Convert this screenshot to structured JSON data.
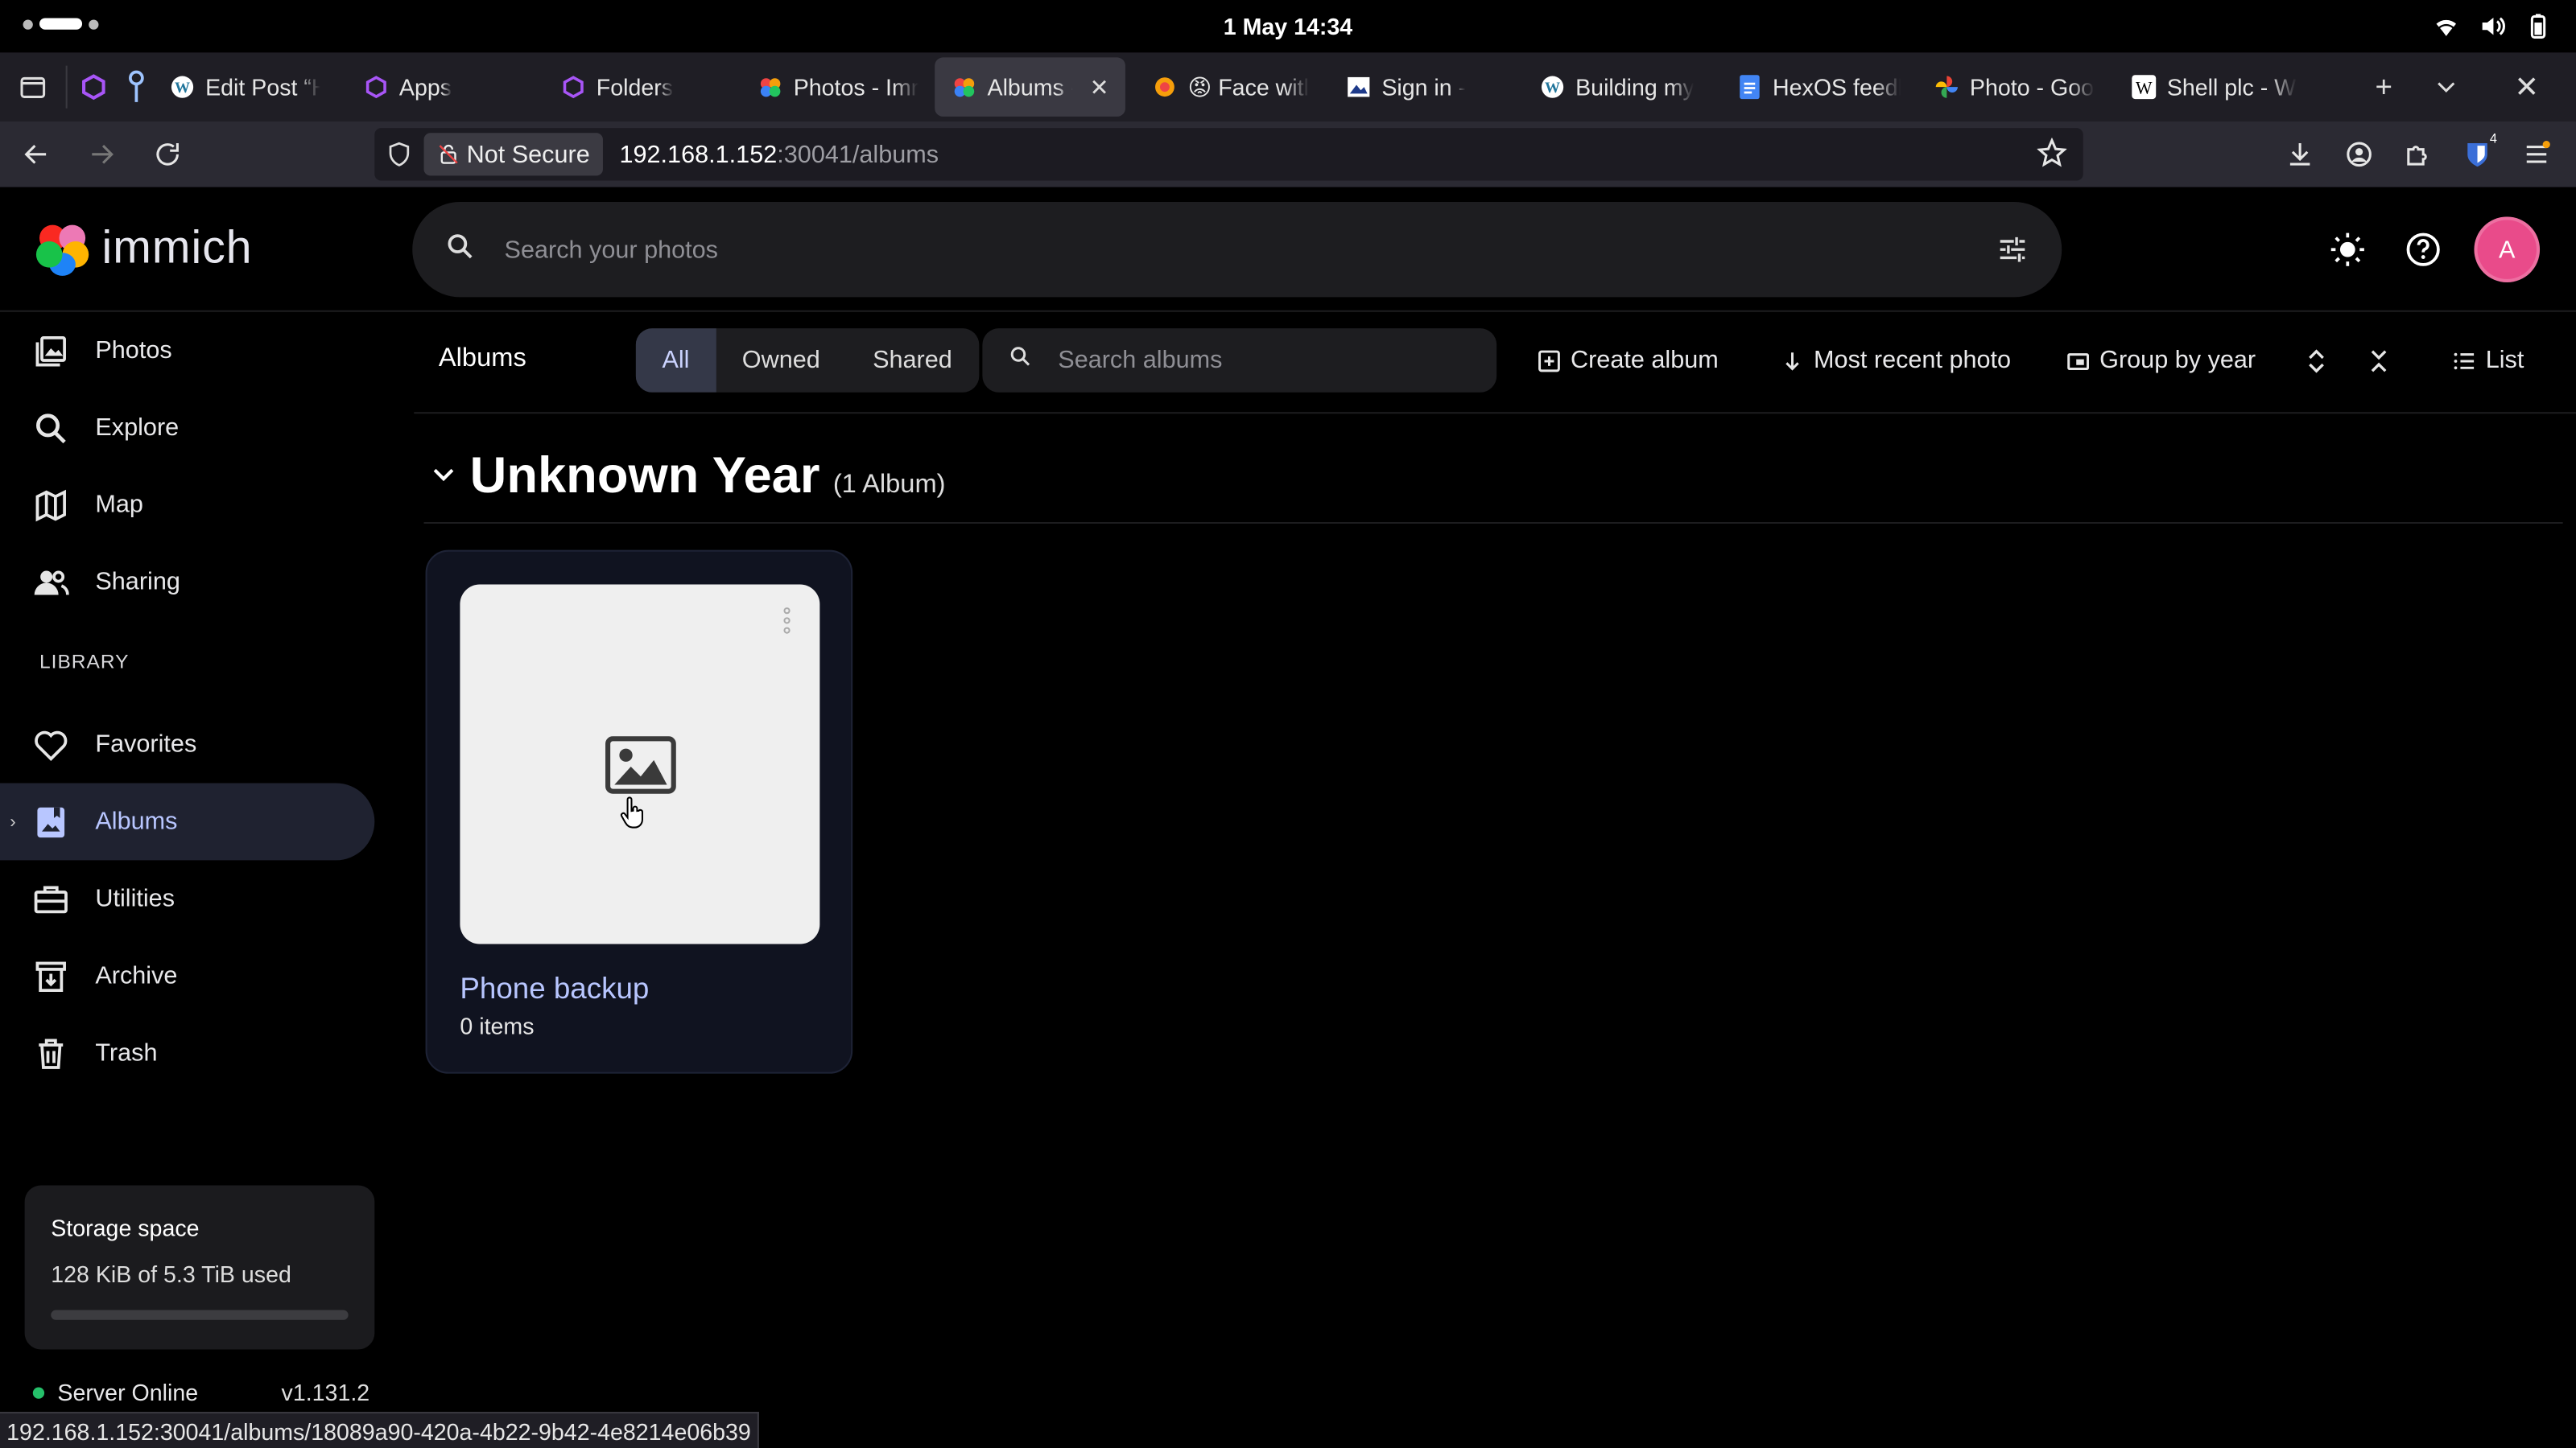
{
  "system": {
    "clock": "1 May  14:34"
  },
  "browser": {
    "tabs": [
      {
        "label": "Edit Post “H",
        "icon": "wordpress-icon"
      },
      {
        "label": "Apps",
        "icon": "hexos-icon"
      },
      {
        "label": "Folders",
        "icon": "hexos-icon"
      },
      {
        "label": "Photos - Imr",
        "icon": "immich-icon"
      },
      {
        "label": "Albums - I",
        "icon": "immich-icon",
        "active": true
      },
      {
        "label": "😡 Face witl",
        "icon": "emoji-icon"
      },
      {
        "label": "Sign in -",
        "icon": "signin-icon"
      },
      {
        "label": "Building my",
        "icon": "wordpress-icon"
      },
      {
        "label": "HexOS feedl",
        "icon": "docs-icon"
      },
      {
        "label": "Photo - Goo",
        "icon": "google-photos-icon"
      },
      {
        "label": "Shell plc - W",
        "icon": "wikipedia-icon"
      }
    ],
    "address": {
      "security": "Not Secure",
      "host": "192.168.1.152",
      "path": ":30041/albums"
    },
    "status_url": "192.168.1.152:30041/albums/18089a90-420a-4b22-9b42-4e8214e06b39",
    "extension_badge": "4"
  },
  "app": {
    "logo_text": "immich",
    "search_placeholder": "Search your photos",
    "avatar_initial": "A"
  },
  "sidebar": {
    "items": [
      {
        "label": "Photos",
        "icon": "photos-icon"
      },
      {
        "label": "Explore",
        "icon": "explore-icon"
      },
      {
        "label": "Map",
        "icon": "map-icon"
      },
      {
        "label": "Sharing",
        "icon": "sharing-icon"
      }
    ],
    "library_label": "LIBRARY",
    "library_items": [
      {
        "label": "Favorites",
        "icon": "heart-icon"
      },
      {
        "label": "Albums",
        "icon": "albums-icon",
        "active": true
      },
      {
        "label": "Utilities",
        "icon": "toolbox-icon"
      },
      {
        "label": "Archive",
        "icon": "archive-icon"
      },
      {
        "label": "Trash",
        "icon": "trash-icon"
      }
    ],
    "storage": {
      "title": "Storage space",
      "used": "128 KiB of 5.3 TiB used",
      "fraction": 2e-05
    },
    "server": {
      "status": "Server Online",
      "version": "v1.131.2"
    }
  },
  "toolbar": {
    "title": "Albums",
    "filters": [
      "All",
      "Owned",
      "Shared"
    ],
    "active_filter": "All",
    "search_placeholder": "Search albums",
    "create": "Create album",
    "sort": "Most recent photo",
    "group": "Group by year",
    "view": "List"
  },
  "group": {
    "title": "Unknown Year",
    "count": "(1 Album)"
  },
  "albums": [
    {
      "name": "Phone backup",
      "count": "0 items"
    }
  ],
  "colors": {
    "accent": "#b8c6ff",
    "avatar": "#e94b8a",
    "online": "#25c06a"
  }
}
